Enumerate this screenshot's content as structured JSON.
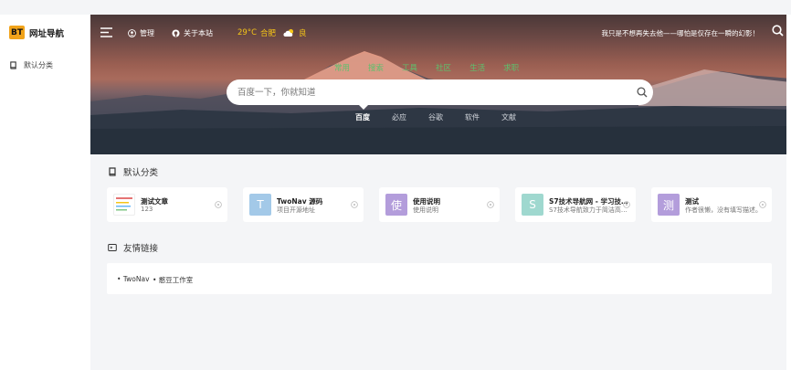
{
  "brand": {
    "logo_text": "BT",
    "name": "网址导航"
  },
  "sidebar": {
    "items": [
      {
        "label": "默认分类",
        "icon": "book-icon"
      }
    ]
  },
  "topbar": {
    "manage_label": "管理",
    "about_label": "关于本站",
    "weather": {
      "temp": "29°C",
      "city": "合肥",
      "quality": "良"
    },
    "slogan": "我只是不想再失去他——哪怕是仅存在一瞬的幻影！"
  },
  "categories": [
    "常用",
    "搜索",
    "工具",
    "社区",
    "生活",
    "求职"
  ],
  "search": {
    "placeholder": "百度一下，你就知道"
  },
  "engines": [
    "百度",
    "必应",
    "谷歌",
    "软件",
    "文献"
  ],
  "sections": {
    "default_title": "默认分类",
    "links_title": "友情链接"
  },
  "cards": [
    {
      "title": "测试文章",
      "desc": "123",
      "thumb_char": "",
      "thumb_color": "#ffffff"
    },
    {
      "title": "TwoNav 源码",
      "desc": "项目开源地址",
      "thumb_char": "T",
      "thumb_color": "#a3c9e8"
    },
    {
      "title": "使用说明",
      "desc": "使用说明",
      "thumb_char": "使",
      "thumb_color": "#b39ddb"
    },
    {
      "title": "S7技术导航网 - 学习技…",
      "desc": "S7技术导航致力于简洁高…",
      "thumb_char": "S",
      "thumb_color": "#9fd8cf"
    },
    {
      "title": "测试",
      "desc": "作者很懒，没有填写描述。",
      "thumb_char": "测",
      "thumb_color": "#b39ddb"
    }
  ],
  "friend_links": [
    "TwoNav",
    "憨豆工作室"
  ],
  "colors": {
    "accent_green": "#5ec06d",
    "weather_yellow": "#f5c518",
    "logo_orange": "#f1a31a"
  }
}
